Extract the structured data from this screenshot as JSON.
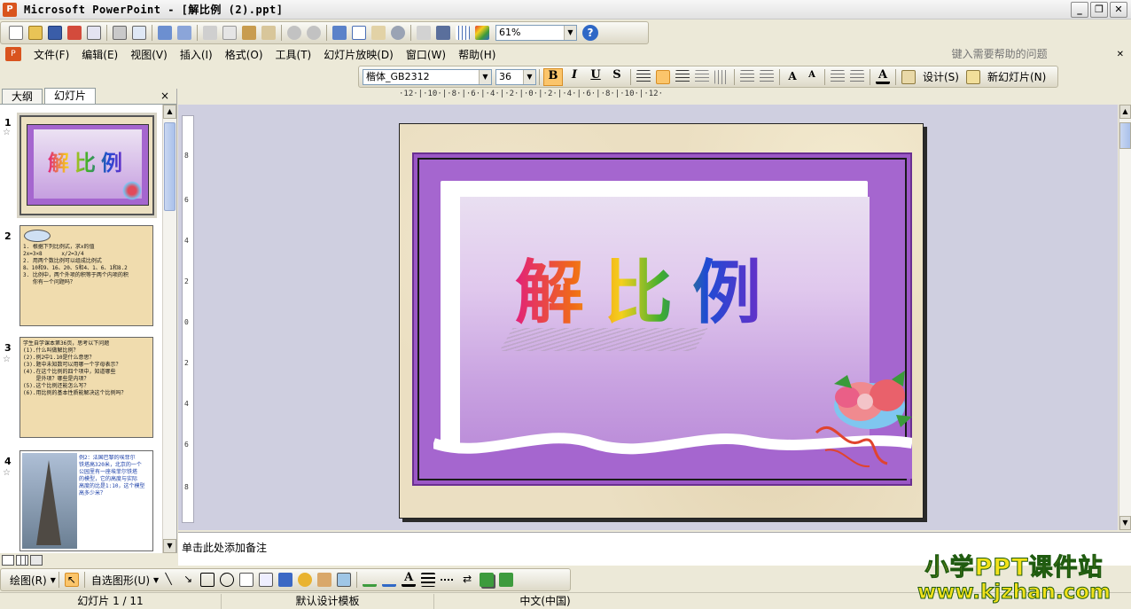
{
  "window": {
    "title": "Microsoft PowerPoint - [解比例 (2).ppt]",
    "app_icon": "powerpoint-icon",
    "controls": [
      "_",
      "❐",
      "✕"
    ]
  },
  "standard_toolbar": {
    "zoom": "61%",
    "icons": [
      "new-icon",
      "open-icon",
      "save-icon",
      "permission-icon",
      "email-icon",
      "print-icon",
      "print-preview-icon",
      "spelling-icon",
      "research-icon",
      "cut-icon",
      "copy-icon",
      "paste-icon",
      "format-painter-icon",
      "undo-icon",
      "redo-icon",
      "insert-chart-icon",
      "insert-table-icon",
      "tables-borders-icon",
      "hyperlink-icon",
      "expand-icon",
      "show-formatting-icon",
      "grid-icon",
      "color-grayscale-icon",
      "help-icon"
    ]
  },
  "menu": {
    "items": [
      "文件(F)",
      "编辑(E)",
      "视图(V)",
      "插入(I)",
      "格式(O)",
      "工具(T)",
      "幻灯片放映(D)",
      "窗口(W)",
      "帮助(H)"
    ],
    "help_placeholder": "键入需要帮助的问题"
  },
  "format_toolbar": {
    "font": "楷体_GB2312",
    "size": "36",
    "bold": "B",
    "italic": "I",
    "underline": "U",
    "shadow": "S",
    "design_label": "设计(S)",
    "new_slide_label": "新幻灯片(N)"
  },
  "left_panel": {
    "tabs": [
      "大纲",
      "幻灯片"
    ],
    "active_tab": "幻灯片",
    "close": "×",
    "thumbnails": [
      {
        "number": "1",
        "title": "解比例"
      },
      {
        "number": "2",
        "text": "1. 根据下列比例式，求x的值\n2x=3×8      x/2=3/4\n2. 用两个数比例可以组成比例式\n8、10和9、16、20、5和4、1、6、1和8.2\n3. 比例中，两个外项的积等于两个内项的积\n   你有一个问题吗？"
      },
      {
        "number": "3",
        "text": "学生自学课本第36页，思考以下问题\n(1).什么叫做解比例？\n(2).例2中1.10是什么意思？\n(3).题中未知数可以用哪一个字母表示？\n(4).在这个比例的四个项中，知道哪些\n    是外项？哪些是内项？\n(5).这个比例还能怎么写？\n(6).用比例的基本性质能解决这个比例吗？"
      },
      {
        "number": "4",
        "text": "例2：法国巴黎的埃菲尔\n铁塔高320米，北京的一个\n公园里有一座埃菲尔铁塔\n的模型，它的高度与实际\n高度的比是1:10，这个模型\n高多少米？"
      }
    ]
  },
  "slide": {
    "title": "解比例"
  },
  "notes": {
    "placeholder": "单击此处添加备注"
  },
  "drawing_toolbar": {
    "draw_label": "绘图(R)",
    "autoshapes_label": "自选图形(U)"
  },
  "status": {
    "slide": "幻灯片 1 / 11",
    "template": "默认设计模板",
    "language": "中文(中国)"
  },
  "watermark": {
    "line1": "小学PPT课件站",
    "line2": "www.kjzhan.com"
  },
  "rulers": {
    "horizontal": "·12·|·10·|·8·|·6·|·4·|·2·|·0·|·2·|·4·|·6·|·8·|·10·|·12·",
    "vertical": [
      "8",
      "6",
      "4",
      "2",
      "0",
      "2",
      "4",
      "6",
      "8"
    ]
  }
}
